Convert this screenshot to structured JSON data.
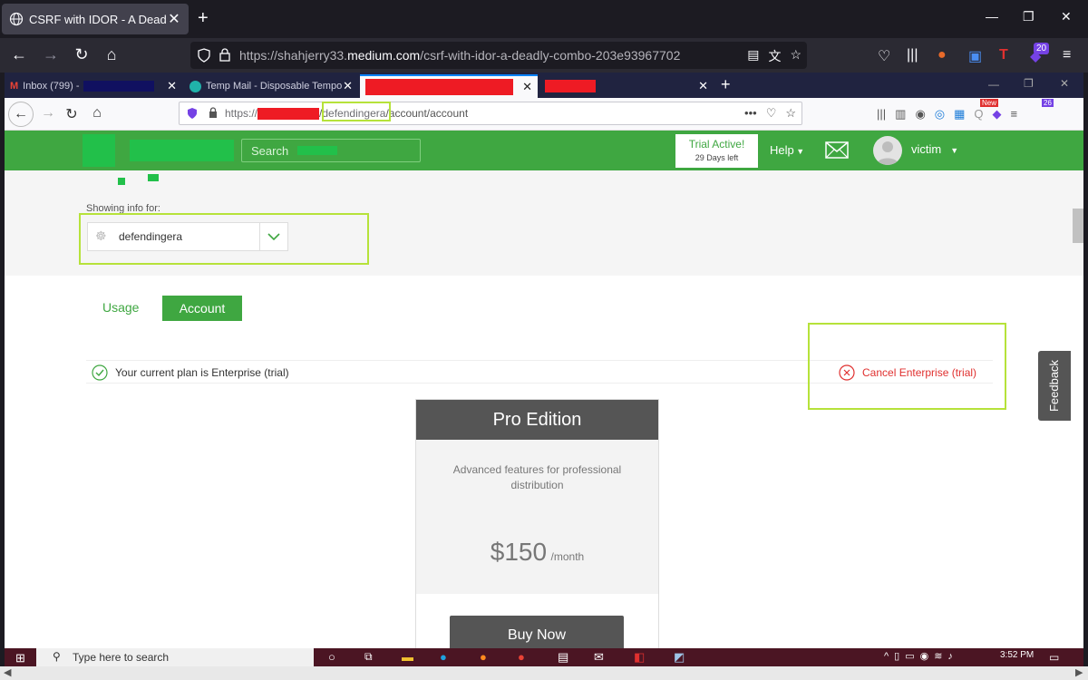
{
  "outer_browser": {
    "tab_title": "CSRF with IDOR - A Deadly Con",
    "url_prefix": "https://shahjerry33.",
    "url_host": "medium.com",
    "url_path": "/csrf-with-idor-a-deadly-combo-203e93967702",
    "addon_badge": "20"
  },
  "inner_browser": {
    "tabs": [
      {
        "title": "Inbox (799) -"
      },
      {
        "title": "Temp Mail - Disposable Tempo"
      }
    ],
    "url_prefix": "https://",
    "url_highlight": "defendingera",
    "url_path": "/account/account",
    "new_badge": "New",
    "ext_badge": "26"
  },
  "app": {
    "search_placeholder": "Search",
    "trial_title": "Trial Active!",
    "trial_days": "29 Days left",
    "help_label": "Help",
    "user_name": "victim",
    "showing_label": "Showing info for:",
    "org_name": "defendingera",
    "tab_usage": "Usage",
    "tab_account": "Account",
    "plan_text": "Your current plan is Enterprise (trial)",
    "cancel_text": "Cancel Enterprise (trial)",
    "card": {
      "title": "Pro Edition",
      "description": "Advanced features for professional distribution",
      "price": "$150",
      "period": "/month",
      "buy_label": "Buy Now"
    },
    "feedback_label": "Feedback"
  },
  "taskbar": {
    "search_placeholder": "Type here to search",
    "time": "3:52 PM"
  },
  "colors": {
    "header_green": "#3fa741",
    "highlight_lime": "#b6e23a",
    "cancel_red": "#e0302f",
    "redaction_red": "#ee1b24"
  }
}
